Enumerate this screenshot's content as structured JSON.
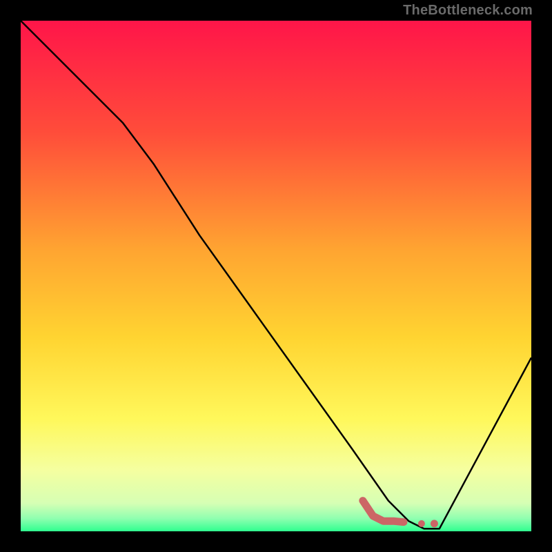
{
  "attribution": "TheBottleneck.com",
  "chart_data": {
    "type": "line",
    "title": "",
    "xlabel": "",
    "ylabel": "",
    "xlim": [
      0,
      100
    ],
    "ylim": [
      0,
      100
    ],
    "grid": false,
    "legend": false,
    "gradient_stops": [
      {
        "offset": 0.0,
        "color": "#ff1549"
      },
      {
        "offset": 0.22,
        "color": "#ff4d3a"
      },
      {
        "offset": 0.45,
        "color": "#ffa531"
      },
      {
        "offset": 0.62,
        "color": "#ffd431"
      },
      {
        "offset": 0.78,
        "color": "#fff85b"
      },
      {
        "offset": 0.88,
        "color": "#f5ffa0"
      },
      {
        "offset": 0.945,
        "color": "#d6ffb4"
      },
      {
        "offset": 0.975,
        "color": "#8fffb0"
      },
      {
        "offset": 1.0,
        "color": "#2fff8f"
      }
    ],
    "series": [
      {
        "name": "bottleneck-curve",
        "color": "#000000",
        "width": 2.5,
        "x": [
          0,
          10,
          20,
          26,
          35,
          45,
          55,
          65,
          72,
          76,
          79,
          82,
          100
        ],
        "values": [
          100,
          90,
          80,
          72,
          58,
          44,
          30,
          16,
          6,
          2,
          0.5,
          0.5,
          34
        ]
      }
    ],
    "marker": {
      "name": "highlight-marker",
      "color": "#cc6666",
      "width": 11,
      "linecap": "round",
      "path": [
        {
          "x": 67,
          "y": 6
        },
        {
          "x": 69,
          "y": 3
        },
        {
          "x": 71,
          "y": 2
        },
        {
          "x": 73,
          "y": 2
        },
        {
          "x": 75,
          "y": 1.8
        }
      ],
      "dots": [
        {
          "x": 78.5,
          "y": 1.5,
          "r": 5
        },
        {
          "x": 81,
          "y": 1.5,
          "r": 5.5
        }
      ]
    }
  }
}
